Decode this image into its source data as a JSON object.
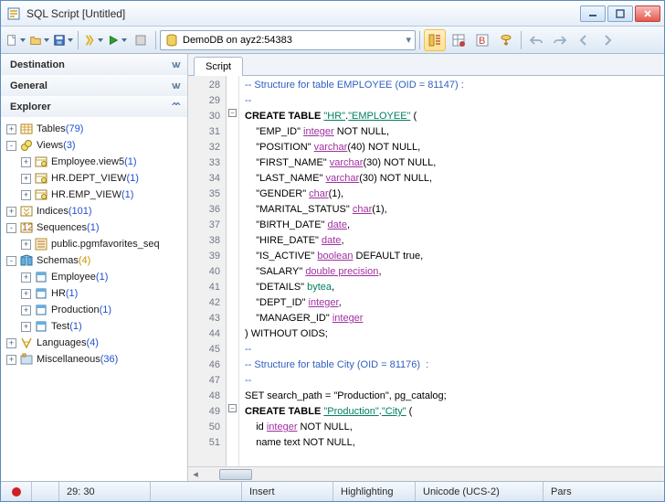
{
  "window": {
    "title": "SQL Script [Untitled]"
  },
  "toolbar": {
    "dbselect": "DemoDB on ayz2:54383"
  },
  "sidebar": {
    "panels": {
      "destination": "Destination",
      "general": "General",
      "explorer": "Explorer"
    },
    "tree": [
      {
        "level": 1,
        "exp": "+",
        "icon": "tables",
        "label": "Tables",
        "count": "(79)"
      },
      {
        "level": 1,
        "exp": "-",
        "icon": "views",
        "label": "Views",
        "count": "(3)"
      },
      {
        "level": 2,
        "exp": "+",
        "icon": "view",
        "label": "Employee.view5",
        "count": "(1)"
      },
      {
        "level": 2,
        "exp": "+",
        "icon": "view",
        "label": "HR.DEPT_VIEW",
        "count": "(1)"
      },
      {
        "level": 2,
        "exp": "+",
        "icon": "view",
        "label": "HR.EMP_VIEW",
        "count": "(1)"
      },
      {
        "level": 1,
        "exp": "+",
        "icon": "indices",
        "label": "Indices",
        "count": "(101)"
      },
      {
        "level": 1,
        "exp": "-",
        "icon": "sequences",
        "label": "Sequences",
        "count": "(1)"
      },
      {
        "level": 2,
        "exp": "+",
        "icon": "seq",
        "label": "public.pgmfavorites_seq",
        "count": ""
      },
      {
        "level": 1,
        "exp": "-",
        "icon": "schemas",
        "label": "Schemas",
        "count": "(4)",
        "cy": true
      },
      {
        "level": 2,
        "exp": "+",
        "icon": "schema",
        "label": "Employee",
        "count": "(1)"
      },
      {
        "level": 2,
        "exp": "+",
        "icon": "schema",
        "label": "HR",
        "count": "(1)"
      },
      {
        "level": 2,
        "exp": "+",
        "icon": "schema",
        "label": "Production",
        "count": "(1)"
      },
      {
        "level": 2,
        "exp": "+",
        "icon": "schema",
        "label": "Test",
        "count": "(1)"
      },
      {
        "level": 1,
        "exp": "+",
        "icon": "lang",
        "label": "Languages",
        "count": "(4)"
      },
      {
        "level": 1,
        "exp": "+",
        "icon": "misc",
        "label": "Miscellaneous",
        "count": "(36)"
      }
    ]
  },
  "editor": {
    "tab": "Script",
    "first_line": 28,
    "lines": [
      {
        "n": 28,
        "html": "<span class='cmt'>-- Structure for table EMPLOYEE (OID = 81147) :</span>"
      },
      {
        "n": 29,
        "html": "<span class='cmt'>--</span>"
      },
      {
        "n": 30,
        "html": "<span class='kw'>CREATE TABLE</span> <span class='str'>\"HR\"</span>.<span class='str'>\"EMPLOYEE\"</span> (",
        "fold": "-"
      },
      {
        "n": 31,
        "html": "    \"EMP_ID\" <span class='typ'>integer</span> NOT NULL,"
      },
      {
        "n": 32,
        "html": "    \"POSITION\" <span class='typ'>varchar</span>(40) NOT NULL,"
      },
      {
        "n": 33,
        "html": "    \"FIRST_NAME\" <span class='typ'>varchar</span>(30) NOT NULL,"
      },
      {
        "n": 34,
        "html": "    \"LAST_NAME\" <span class='typ'>varchar</span>(30) NOT NULL,"
      },
      {
        "n": 35,
        "html": "    \"GENDER\" <span class='typ'>char</span>(1),"
      },
      {
        "n": 36,
        "html": "    \"MARITAL_STATUS\" <span class='typ'>char</span>(1),"
      },
      {
        "n": 37,
        "html": "    \"BIRTH_DATE\" <span class='typ'>date</span>,"
      },
      {
        "n": 38,
        "html": "    \"HIRE_DATE\" <span class='typ'>date</span>,"
      },
      {
        "n": 39,
        "html": "    \"IS_ACTIVE\" <span class='typ'>boolean</span> DEFAULT true,"
      },
      {
        "n": 40,
        "html": "    \"SALARY\" <span class='typ'>double precision</span>,"
      },
      {
        "n": 41,
        "html": "    \"DETAILS\" <span class='id2'>bytea</span>,"
      },
      {
        "n": 42,
        "html": "    \"DEPT_ID\" <span class='typ'>integer</span>,"
      },
      {
        "n": 43,
        "html": "    \"MANAGER_ID\" <span class='typ'>integer</span>"
      },
      {
        "n": 44,
        "html": ") WITHOUT OIDS;"
      },
      {
        "n": 45,
        "html": "<span class='cmt'>--</span>"
      },
      {
        "n": 46,
        "html": "<span class='cmt'>-- Structure for table City (OID = 81176)  :</span>"
      },
      {
        "n": 47,
        "html": "<span class='cmt'>--</span>"
      },
      {
        "n": 48,
        "html": "SET search_path = \"Production\", pg_catalog;"
      },
      {
        "n": 49,
        "html": "<span class='kw'>CREATE TABLE</span> <span class='str'>\"Production\"</span>.<span class='str'>\"City\"</span> (",
        "fold": "-"
      },
      {
        "n": 50,
        "html": "    id <span class='typ'>integer</span> NOT NULL,"
      },
      {
        "n": 51,
        "html": "    name text NOT NULL,"
      }
    ]
  },
  "status": {
    "pos": "29:  30",
    "mode": "Insert",
    "hl": "Highlighting",
    "enc": "Unicode (UCS-2)",
    "parse": "Pars"
  }
}
